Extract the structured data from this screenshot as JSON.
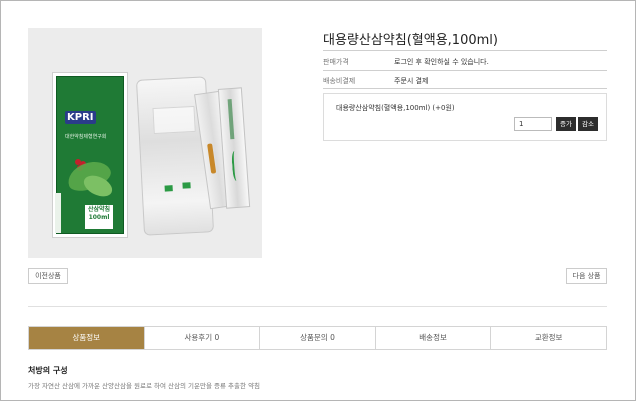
{
  "product": {
    "title": "대용량산삼약침(혈액용,100ml)",
    "price_label": "판매가격",
    "price_value": "로그인 후 확인하실 수 있습니다.",
    "shipping_label": "배송비결제",
    "shipping_value": "주문시 결제",
    "image_box_brand": "KPRI",
    "image_box_org": "대한약침제형연구회",
    "image_box_product": "산삼약침",
    "image_box_volume": "100ml"
  },
  "option": {
    "name": "대용량산삼약침(혈액용,100ml) (+0원)",
    "quantity": "1",
    "increase_label": "증가",
    "decrease_label": "감소"
  },
  "navigation": {
    "prev_label": "이전상품",
    "next_label": "다음 상품"
  },
  "tabs": [
    {
      "label": "상품정보",
      "active": true
    },
    {
      "label": "사용후기 0",
      "active": false
    },
    {
      "label": "상품문의 0",
      "active": false
    },
    {
      "label": "배송정보",
      "active": false
    },
    {
      "label": "교환정보",
      "active": false
    }
  ],
  "section": {
    "title": "처방의 구성",
    "description": "가장 자연산 산삼에 가까운 산양산삼을 원료로 하여 산삼의 기운만을 증류 추출한 약침"
  },
  "colors": {
    "active_tab": "#a68343",
    "button_dark": "#2d2d2d"
  }
}
